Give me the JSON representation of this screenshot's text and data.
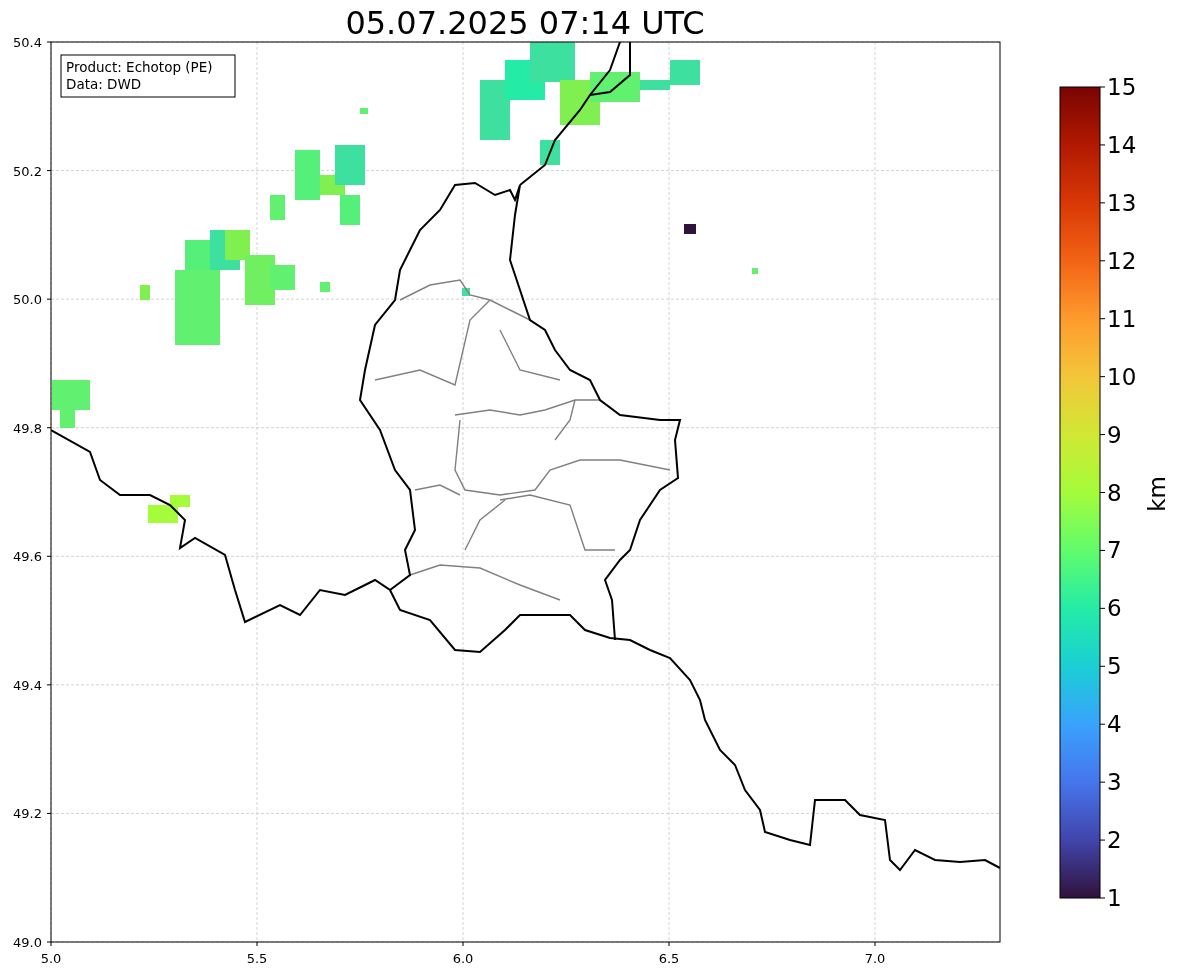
{
  "title": "05.07.2025 07:14 UTC",
  "legend": [
    "Product: Echotop (PE)",
    "Data: DWD"
  ],
  "x_ticks": [
    "5.0",
    "5.5",
    "6.0",
    "6.5",
    "7.0"
  ],
  "y_ticks": [
    "50.4",
    "50.2",
    "50.0",
    "49.8",
    "49.6",
    "49.4",
    "49.2",
    "49.0"
  ],
  "colorbar": {
    "ticks": [
      "15",
      "14",
      "13",
      "12",
      "11",
      "10",
      "9",
      "8",
      "7",
      "6",
      "5",
      "4",
      "3",
      "2",
      "1"
    ],
    "label": "km"
  }
}
